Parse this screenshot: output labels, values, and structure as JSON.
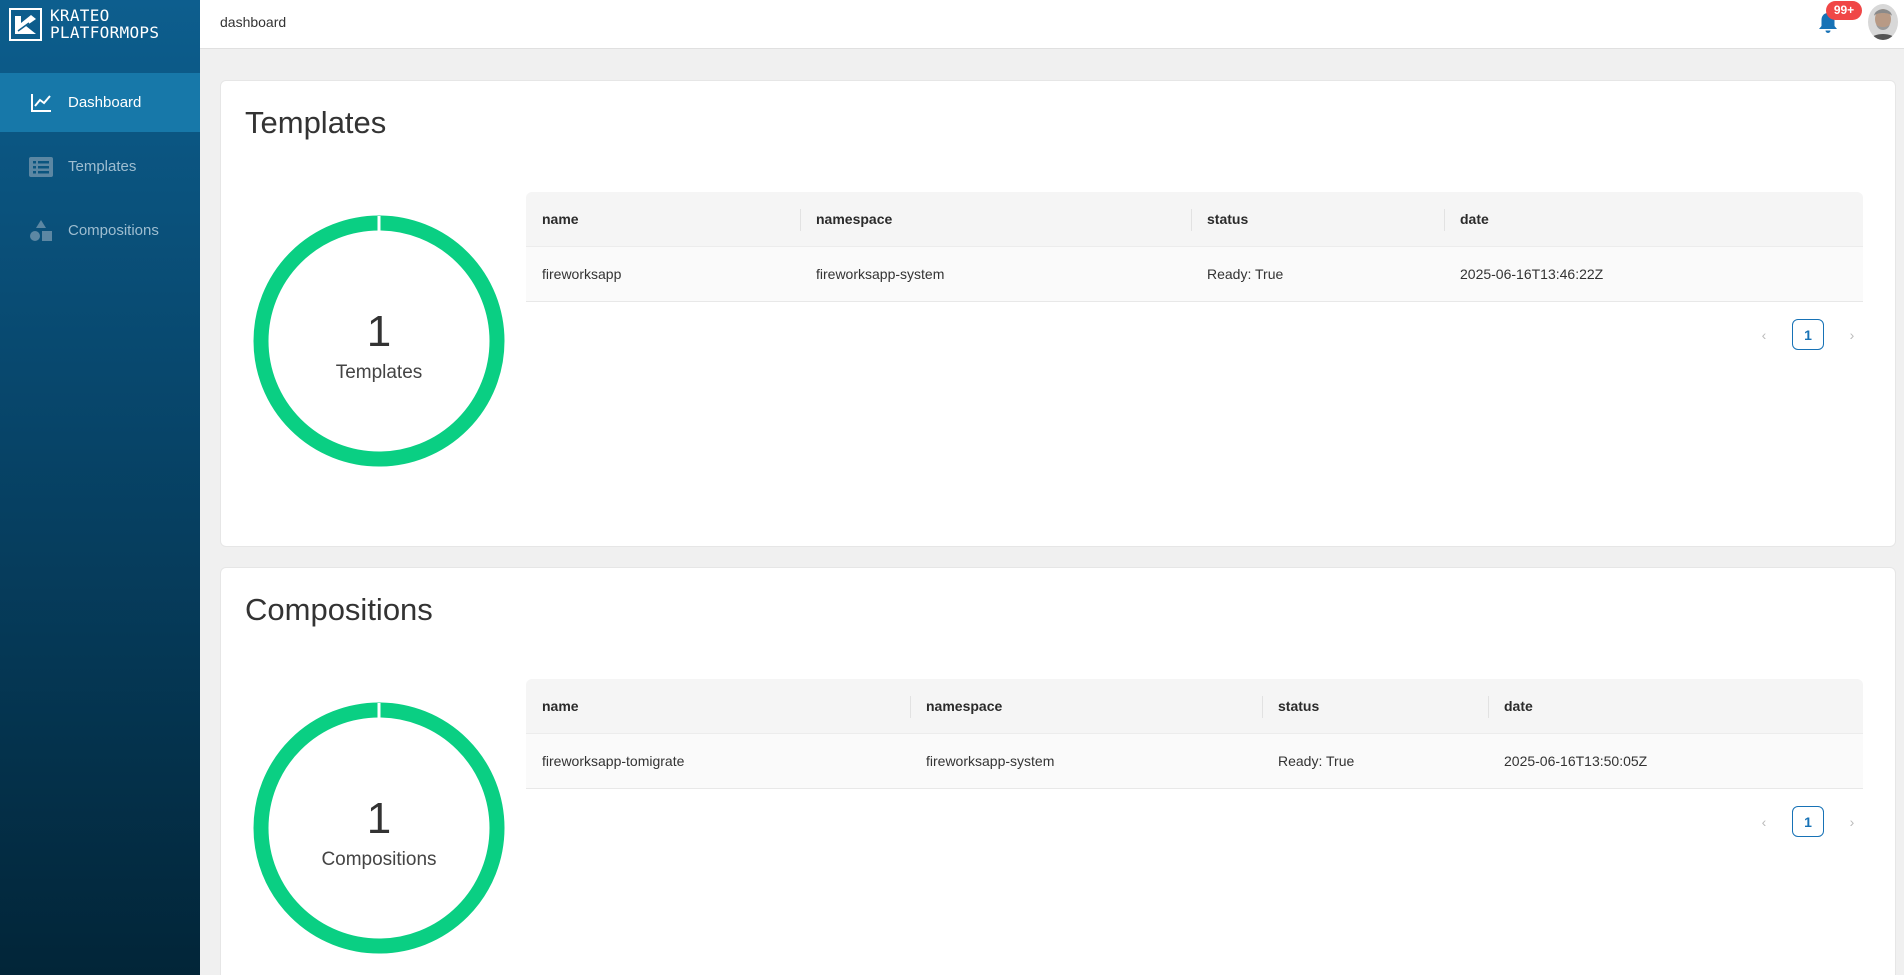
{
  "brand": {
    "line1": "KRATEO",
    "line2": "PLATFORMOPS"
  },
  "colors": {
    "accent": "#1772b6",
    "donut": "#0acf83",
    "badge": "#f04747",
    "sidebar_active": "#1778a9"
  },
  "sidebar": {
    "items": [
      {
        "label": "Dashboard",
        "icon": "line-chart-icon",
        "active": true
      },
      {
        "label": "Templates",
        "icon": "list-icon",
        "active": false
      },
      {
        "label": "Compositions",
        "icon": "shapes-icon",
        "active": false
      }
    ]
  },
  "topbar": {
    "breadcrumb": "dashboard",
    "notifications_badge": "99+"
  },
  "templates": {
    "title": "Templates",
    "count": "1",
    "count_label": "Templates",
    "columns": [
      "name",
      "namespace",
      "status",
      "date"
    ],
    "rows": [
      {
        "name": "fireworksapp",
        "namespace": "fireworksapp-system",
        "status": "Ready: True",
        "date": "2025-06-16T13:46:22Z"
      }
    ],
    "page": "1",
    "prev": "‹",
    "next": "›"
  },
  "compositions": {
    "title": "Compositions",
    "count": "1",
    "count_label": "Compositions",
    "columns": [
      "name",
      "namespace",
      "status",
      "date"
    ],
    "rows": [
      {
        "name": "fireworksapp-tomigrate",
        "namespace": "fireworksapp-system",
        "status": "Ready: True",
        "date": "2025-06-16T13:50:05Z"
      }
    ],
    "page": "1",
    "prev": "‹",
    "next": "›"
  }
}
